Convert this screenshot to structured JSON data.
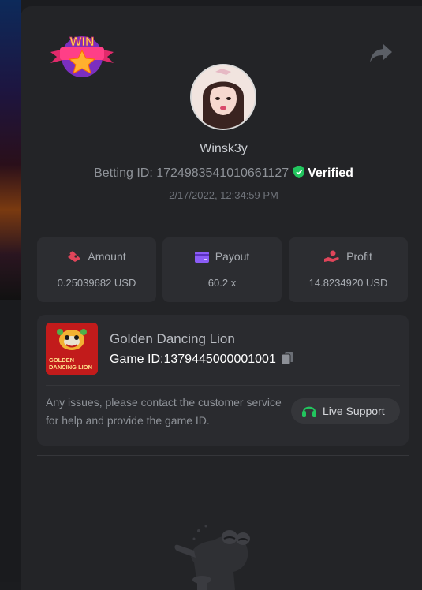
{
  "header": {
    "logo_text": "WIN",
    "share_icon": "share-icon"
  },
  "user": {
    "name": "Winsk3y",
    "betting_id_label": "Betting ID: 1724983541010661127",
    "verified_label": "Verified",
    "datetime": "2/17/2022, 12:34:59 PM"
  },
  "stats": [
    {
      "label": "Amount",
      "value": "0.25039682 USD",
      "icon": "amount-icon",
      "color": "#e0455a"
    },
    {
      "label": "Payout",
      "value": "60.2 x",
      "icon": "payout-card-icon",
      "color": "#8b5cf6"
    },
    {
      "label": "Profit",
      "value": "14.8234920 USD",
      "icon": "profit-hand-icon",
      "color": "#e0455a"
    }
  ],
  "game": {
    "name": "Golden Dancing Lion",
    "id_label": "Game ID:",
    "id_value": "1379445000001001",
    "thumb_text_1": "GOLDEN",
    "thumb_text_2": "DANCING LION",
    "help_text": "Any issues, please contact the customer service for help and provide the game ID.",
    "support_label": "Live Support"
  },
  "colors": {
    "verified_green": "#22c55e",
    "support_green": "#22c55e",
    "panel": "#232427",
    "card": "#2c2d31"
  }
}
